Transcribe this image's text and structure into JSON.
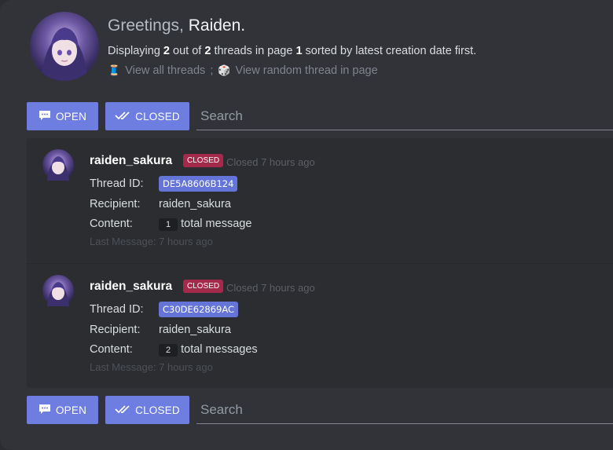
{
  "header": {
    "greeting_prefix": "Greetings, ",
    "greeting_name": "Raiden.",
    "summary": {
      "t1": "Displaying ",
      "shown": "2",
      "t2": " out of ",
      "total": "2",
      "t3": " threads in page ",
      "page": "1",
      "t4": " sorted by latest creation date first."
    },
    "links": {
      "view_all_emoji": "🧵",
      "view_all": "View all threads",
      "separator": ";",
      "random_emoji": "🎲",
      "random": "View random thread in page"
    }
  },
  "toolbar": {
    "open_label": "OPEN",
    "closed_label": "CLOSED",
    "search_placeholder": "Search",
    "open_icon": "chat-bubble-icon",
    "closed_icon": "double-check-icon"
  },
  "threads": [
    {
      "username": "raiden_sakura",
      "status": "CLOSED",
      "closed_time": "Closed 7 hours ago",
      "thread_id_label": "Thread ID:",
      "thread_id": "DE5A8606B124",
      "recipient_label": "Recipient:",
      "recipient": "raiden_sakura",
      "content_label": "Content:",
      "message_count": "1",
      "message_unit": "total message",
      "last_message": "Last Message: 7 hours ago"
    },
    {
      "username": "raiden_sakura",
      "status": "CLOSED",
      "closed_time": "Closed 7 hours ago",
      "thread_id_label": "Thread ID:",
      "thread_id": "C30DE62869AC",
      "recipient_label": "Recipient:",
      "recipient": "raiden_sakura",
      "content_label": "Content:",
      "message_count": "2",
      "message_unit": "total messages",
      "last_message": "Last Message: 7 hours ago"
    }
  ],
  "colors": {
    "background": "#313338",
    "panel": "#2b2d31",
    "accent_button": "#6d7de0",
    "closed_badge": "#a42a4c",
    "thread_id_chip": "#6474d9"
  }
}
